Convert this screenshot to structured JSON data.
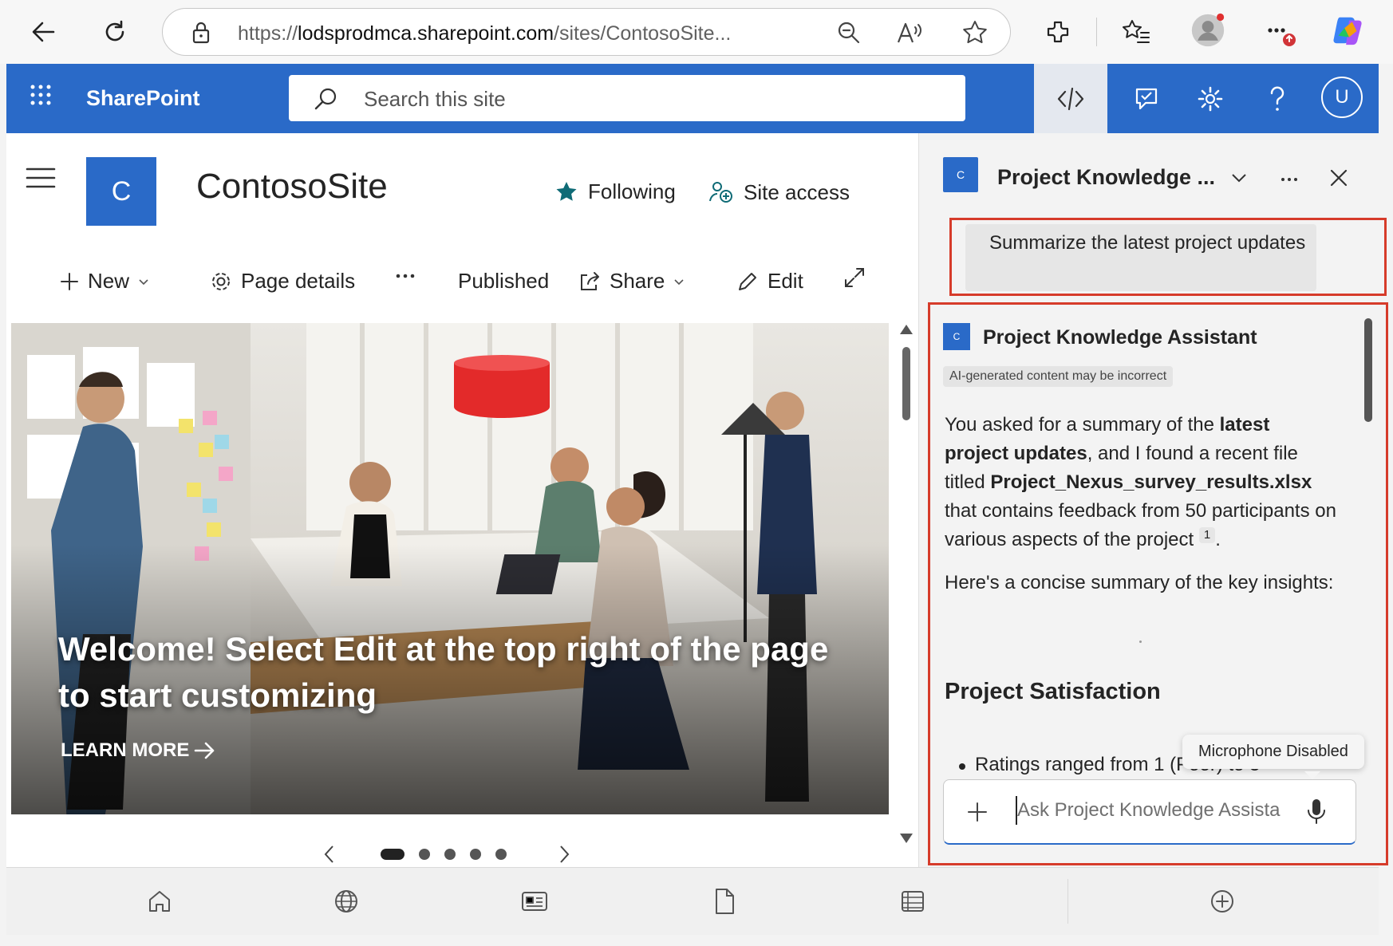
{
  "browser": {
    "url_prefix": "https://",
    "url_domain": "lodsprodmca.sharepoint.com",
    "url_path": "/sites/ContosoSite..."
  },
  "suite": {
    "brand": "SharePoint",
    "search_placeholder": "Search this site",
    "avatar_initial": "U",
    "accent_color": "#2a6ac8"
  },
  "site": {
    "logo_letter": "C",
    "title": "ContosoSite",
    "following_label": "Following",
    "site_access_label": "Site access"
  },
  "commands": {
    "new_label": "New",
    "page_details_label": "Page details",
    "status_label": "Published",
    "share_label": "Share",
    "edit_label": "Edit"
  },
  "hero": {
    "text": "Welcome! Select Edit at the top right of the page to start customizing",
    "learn_more": "LEARN MORE"
  },
  "pane": {
    "logo_letter": "C",
    "title": "Project Knowledge ...",
    "user_message": "Summarize the latest project updates",
    "assistant_name": "Project Knowledge Assistant",
    "ai_badge": "AI-generated content may be incorrect",
    "p1_a": "You asked for a summary of the ",
    "p1_b": "latest project updates",
    "p1_c": ", and I found a recent file titled ",
    "p1_d": "Project_Nexus_survey_results.xlsx",
    "p1_e": " that contains feedback from 50 participants on various aspects of the project ",
    "citation": "1",
    "p1_end": ".",
    "p2": "Here's a concise summary of the key insights:",
    "section_heading": "Project Satisfaction",
    "bullet_text": "Ratings ranged from 1 (Poor) to 5",
    "tooltip": "Microphone Disabled",
    "input_placeholder": "Ask Project Knowledge Assistant"
  }
}
